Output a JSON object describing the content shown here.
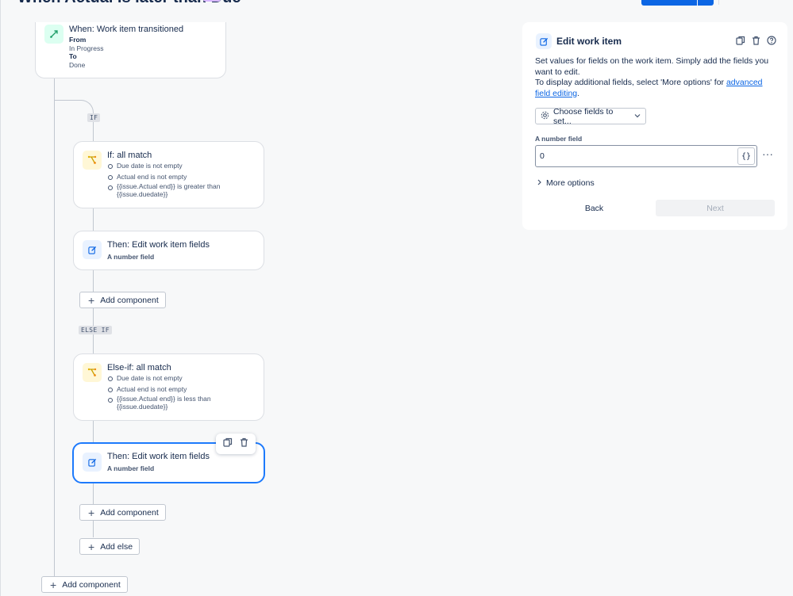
{
  "header": {
    "rule_title": "When Actual is later than Due"
  },
  "flow": {
    "trigger": {
      "title": "When: Work item transitioned",
      "from_label": "From",
      "from_value": "In Progress",
      "to_label": "To",
      "to_value": "Done"
    },
    "if_tag": "IF",
    "if_card": {
      "title": "If: all match",
      "conditions": [
        "Due date is not empty",
        "Actual end is not empty",
        "{{issue.Actual end}} is greater than",
        "{{issue.duedate}}"
      ]
    },
    "then1": {
      "title": "Then: Edit work item fields",
      "field": "A number field"
    },
    "add_component_1": "Add component",
    "else_if_tag": "ELSE IF",
    "else_if_card": {
      "title": "Else-if: all match",
      "conditions": [
        "Due date is not empty",
        "Actual end is not empty",
        "{{issue.Actual end}} is less than",
        "{{issue.duedate}}"
      ]
    },
    "then2": {
      "title": "Then: Edit work item fields",
      "field": "A number field"
    },
    "add_component_2": "Add component",
    "add_else": "Add else",
    "add_component_root": "Add component"
  },
  "panel": {
    "title": "Edit work item",
    "desc_line1": "Set values for fields on the work item. Simply add the fields you want to edit.",
    "desc_line2_prefix": "To display additional fields, select 'More options' for ",
    "desc_link": "advanced field editing",
    "desc_line2_suffix": ".",
    "choose_fields": "Choose fields to set...",
    "field_label": "A number field",
    "field_value": "0",
    "braces": "{}",
    "more_options": "More options",
    "back": "Back",
    "next": "Next"
  },
  "colors": {
    "primary": "#0c66e4",
    "selected_border": "#1d7afc",
    "trigger_icon": "#22a06b",
    "condition_icon": "#e2b203"
  }
}
